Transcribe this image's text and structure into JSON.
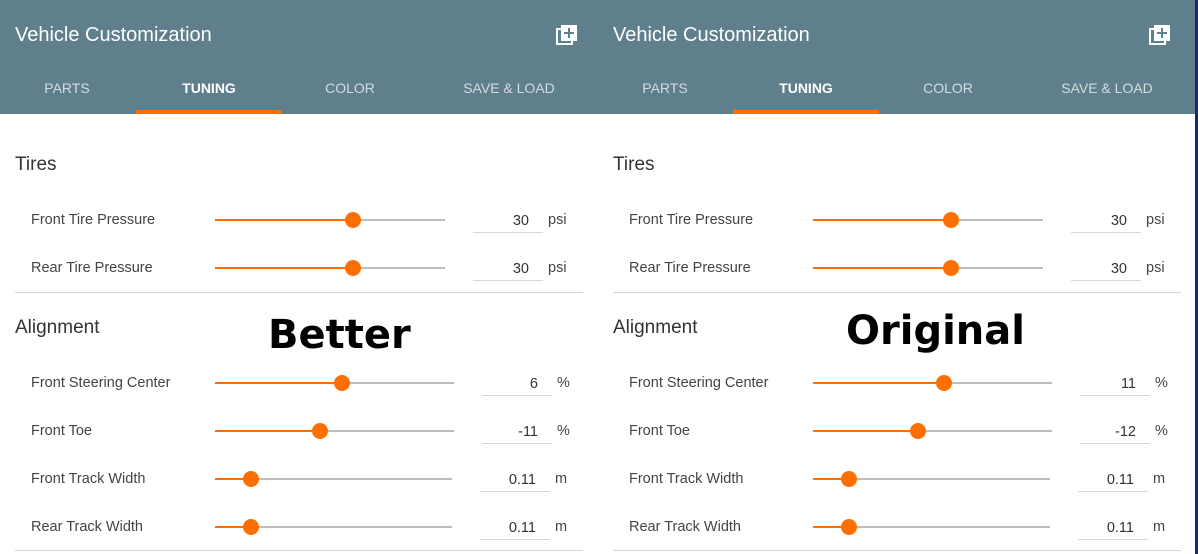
{
  "panels": [
    {
      "title": "Vehicle Customization",
      "tabs": [
        "PARTS",
        "TUNING",
        "COLOR",
        "SAVE & LOAD"
      ],
      "active_tab": "TUNING",
      "overlay_label": "Better",
      "tires": {
        "heading": "Tires",
        "rows": [
          {
            "label": "Front Tire Pressure",
            "value": "30",
            "unit": "psi",
            "fraction": 0.6
          },
          {
            "label": "Rear Tire Pressure",
            "value": "30",
            "unit": "psi",
            "fraction": 0.6
          }
        ]
      },
      "alignment": {
        "heading": "Alignment",
        "rows": [
          {
            "label": "Front Steering Center",
            "value": "6",
            "unit": "%",
            "fraction": 0.53
          },
          {
            "label": "Front Toe",
            "value": "-11",
            "unit": "%",
            "fraction": 0.44
          },
          {
            "label": "Front Track Width",
            "value": "0.11",
            "unit": "m",
            "fraction": 0.15
          },
          {
            "label": "Rear Track Width",
            "value": "0.11",
            "unit": "m",
            "fraction": 0.15
          }
        ]
      }
    },
    {
      "title": "Vehicle Customization",
      "tabs": [
        "PARTS",
        "TUNING",
        "COLOR",
        "SAVE & LOAD"
      ],
      "active_tab": "TUNING",
      "overlay_label": "Original",
      "tires": {
        "heading": "Tires",
        "rows": [
          {
            "label": "Front Tire Pressure",
            "value": "30",
            "unit": "psi",
            "fraction": 0.6
          },
          {
            "label": "Rear Tire Pressure",
            "value": "30",
            "unit": "psi",
            "fraction": 0.6
          }
        ]
      },
      "alignment": {
        "heading": "Alignment",
        "rows": [
          {
            "label": "Front Steering Center",
            "value": "11",
            "unit": "%",
            "fraction": 0.55
          },
          {
            "label": "Front Toe",
            "value": "-12",
            "unit": "%",
            "fraction": 0.44
          },
          {
            "label": "Front Track Width",
            "value": "0.11",
            "unit": "m",
            "fraction": 0.15
          },
          {
            "label": "Rear Track Width",
            "value": "0.11",
            "unit": "m",
            "fraction": 0.15
          }
        ]
      }
    }
  ],
  "colors": {
    "header_bg": "#5f7f8c",
    "accent": "#ff6f00",
    "track": "#bdbdbd"
  },
  "icons": {
    "header_action": "add-to-library-icon"
  }
}
